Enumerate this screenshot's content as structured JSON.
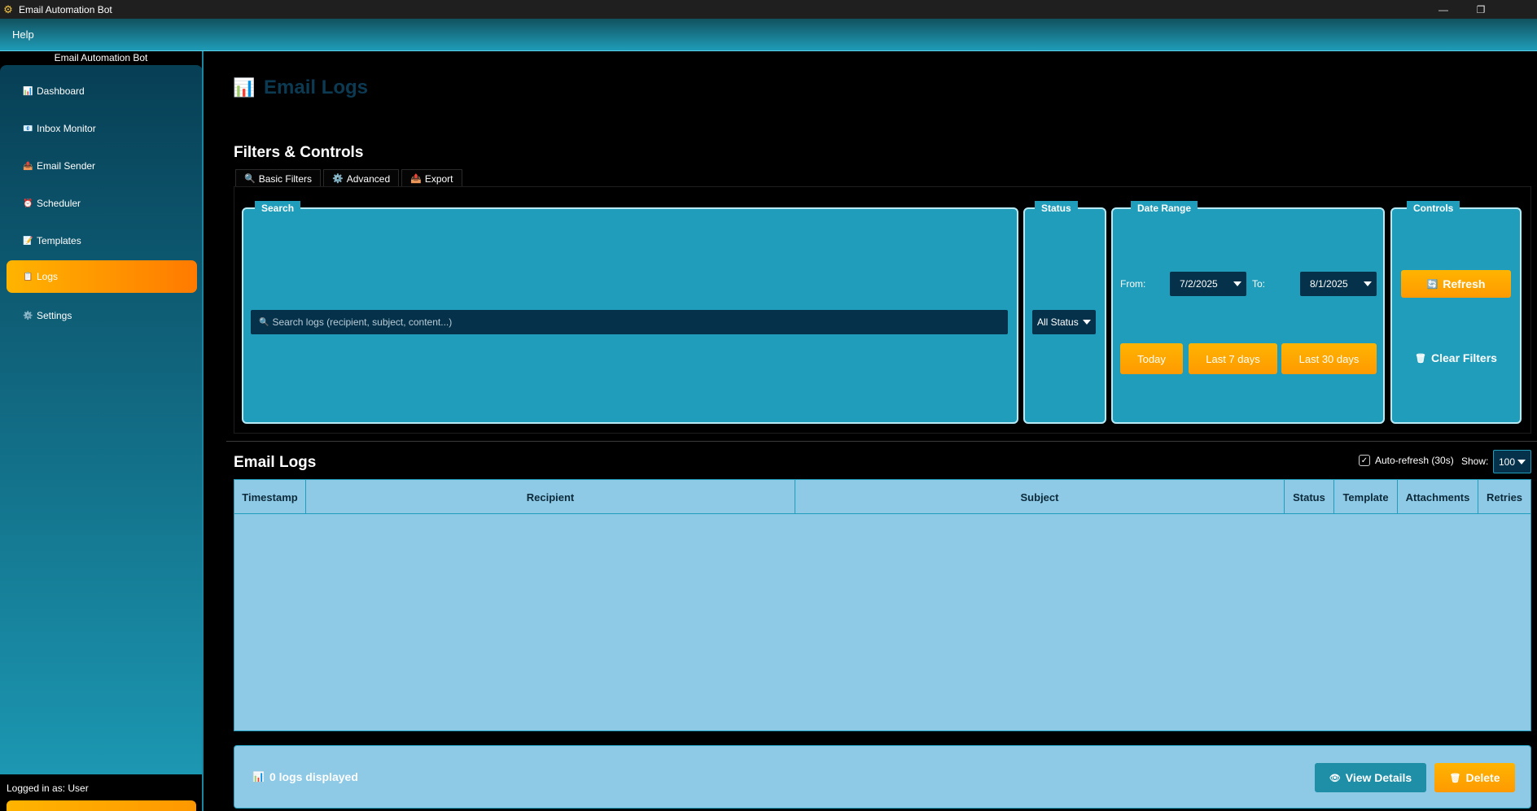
{
  "window": {
    "title": "Email Automation Bot",
    "app_icon": "gear-bot-icon",
    "minimize_glyph": "—",
    "restore_glyph": "❐"
  },
  "menubar": {
    "help_label": "Help"
  },
  "sidebar": {
    "title": "Email Automation Bot",
    "items": [
      {
        "label": "Dashboard",
        "icon": "📊",
        "active": false
      },
      {
        "label": "Inbox Monitor",
        "icon": "📧",
        "active": false
      },
      {
        "label": "Email Sender",
        "icon": "📤",
        "active": false
      },
      {
        "label": "Scheduler",
        "icon": "⏰",
        "active": false
      },
      {
        "label": "Templates",
        "icon": "📝",
        "active": false
      },
      {
        "label": "Logs",
        "icon": "📋",
        "active": true
      },
      {
        "label": "Settings",
        "icon": "⚙️",
        "active": false
      }
    ],
    "login_text": "Logged in as: User"
  },
  "page": {
    "title": "Email Logs",
    "icon": "📊"
  },
  "filters": {
    "section_title": "Filters & Controls",
    "tabs": [
      {
        "label": "Basic Filters",
        "icon": "🔍"
      },
      {
        "label": "Advanced",
        "icon": "⚙️"
      },
      {
        "label": "Export",
        "icon": "📤"
      }
    ],
    "search": {
      "group_label": "Search",
      "placeholder": "Search logs (recipient, subject, content...)",
      "icon": "🔍"
    },
    "status": {
      "group_label": "Status",
      "selected": "All Status"
    },
    "date_range": {
      "group_label": "Date Range",
      "from_label": "From:",
      "from_value": "7/2/2025",
      "to_label": "To:",
      "to_value": "8/1/2025",
      "today_label": "Today",
      "last7_label": "Last 7 days",
      "last30_label": "Last 30 days"
    },
    "controls": {
      "group_label": "Controls",
      "refresh_label": "Refresh",
      "refresh_icon": "🔄",
      "clear_label": "Clear Filters",
      "clear_icon": "🗑"
    }
  },
  "logs": {
    "section_title": "Email Logs",
    "auto_refresh_label": "Auto-refresh (30s)",
    "auto_refresh_checked": true,
    "show_label": "Show:",
    "show_value": "100",
    "columns": [
      "Timestamp",
      "Recipient",
      "Subject",
      "Status",
      "Template",
      "Attachments",
      "Retries"
    ],
    "rows": []
  },
  "status_bar": {
    "text": "0 logs displayed",
    "icon": "📊",
    "view_details_label": "View Details",
    "view_details_icon": "👁",
    "delete_label": "Delete",
    "delete_icon": "🗑"
  },
  "colors": {
    "accent_orange": "#ffa500",
    "panel_teal": "#1f9dbb",
    "table_bg": "#8ecae6",
    "input_bg": "#05324a",
    "title_dark": "#0c3a52"
  }
}
